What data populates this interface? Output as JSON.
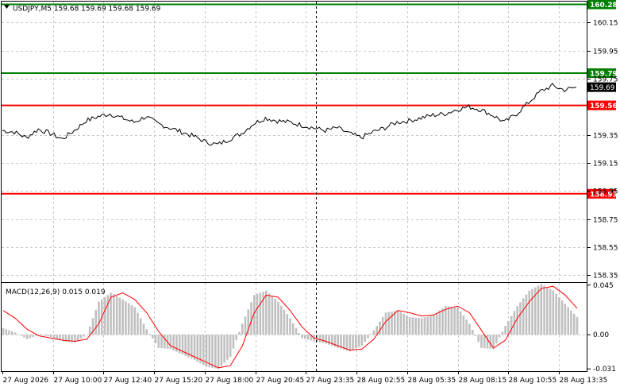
{
  "header": {
    "symbol_line": "USDJPY,M5  159.68 159.69 159.68 159.69"
  },
  "macd": {
    "label": "MACD(12,26,9) 0.015 0.019",
    "axis_labels": [
      "0.045",
      "0.00",
      "-0.031"
    ]
  },
  "colors": {
    "green_line": "#008000",
    "red_line": "#ff0000",
    "price_line": "#000000",
    "histogram": "#c0c0c0",
    "signal": "#ff0000",
    "grid": "#c8c8c8"
  },
  "chart_data": [
    {
      "type": "line",
      "title": "USDJPY,M5",
      "price_axis_ticks": [
        "160.15",
        "159.95",
        "159.75",
        "159.35",
        "159.15",
        "158.95",
        "158.75",
        "158.55",
        "158.35"
      ],
      "ylim": [
        158.3,
        160.3
      ],
      "time_labels": [
        "27 Aug 2026",
        "27 Aug 10:00",
        "27 Aug 12:40",
        "27 Aug 15:20",
        "27 Aug 18:00",
        "27 Aug 20:45",
        "27 Aug 23:35",
        "28 Aug 02:55",
        "28 Aug 05:35",
        "28 Aug 08:15",
        "28 Aug 10:55",
        "28 Aug 13:35"
      ],
      "levels": [
        {
          "value": 160.28,
          "label": "160.28",
          "color": "green"
        },
        {
          "value": 159.79,
          "label": "159.79",
          "color": "green"
        },
        {
          "value": 159.56,
          "label": "159.56",
          "color": "red"
        },
        {
          "value": 158.93,
          "label": "158.93",
          "color": "red"
        }
      ],
      "current_price": {
        "value": 159.69,
        "label": "159.69"
      },
      "series": [
        {
          "values": [
            159.38,
            159.37,
            159.33,
            159.39,
            159.36,
            159.32,
            159.38,
            159.45,
            159.48,
            159.5,
            159.47,
            159.44,
            159.48,
            159.43,
            159.4,
            159.37,
            159.34,
            159.3,
            159.28,
            159.32,
            159.36,
            159.43,
            159.47,
            159.45,
            159.44,
            159.42,
            159.4,
            159.38,
            159.4,
            159.36,
            159.33,
            159.37,
            159.4,
            159.44,
            159.45,
            159.47,
            159.49,
            159.5,
            159.53,
            159.55,
            159.53,
            159.49,
            159.44,
            159.5,
            159.58,
            159.66,
            159.7,
            159.67,
            159.69
          ]
        }
      ]
    },
    {
      "type": "bar",
      "title": "MACD(12,26,9)",
      "ylim": [
        -0.033,
        0.047
      ],
      "series": [
        {
          "name": "MACD",
          "values": [
            0.006,
            0.002,
            -0.004,
            0.0,
            -0.002,
            -0.006,
            -0.007,
            0.0,
            0.03,
            0.038,
            0.032,
            0.025,
            0.005,
            -0.012,
            -0.013,
            -0.018,
            -0.023,
            -0.029,
            -0.031,
            -0.02,
            0.01,
            0.036,
            0.04,
            0.03,
            0.015,
            -0.003,
            -0.006,
            -0.008,
            -0.012,
            -0.015,
            -0.01,
            0.004,
            0.02,
            0.022,
            0.016,
            0.015,
            0.018,
            0.026,
            0.025,
            0.01,
            -0.012,
            -0.013,
            0.008,
            0.026,
            0.04,
            0.046,
            0.04,
            0.028,
            0.016
          ]
        },
        {
          "name": "Signal",
          "values": [
            0.022,
            0.015,
            0.005,
            -0.001,
            -0.003,
            -0.005,
            -0.006,
            -0.004,
            0.01,
            0.034,
            0.038,
            0.032,
            0.02,
            0.003,
            -0.01,
            -0.015,
            -0.02,
            -0.025,
            -0.03,
            -0.028,
            -0.01,
            0.02,
            0.036,
            0.034,
            0.022,
            0.007,
            -0.003,
            -0.006,
            -0.01,
            -0.014,
            -0.013,
            -0.004,
            0.012,
            0.022,
            0.02,
            0.017,
            0.018,
            0.023,
            0.026,
            0.02,
            0.004,
            -0.012,
            -0.005,
            0.015,
            0.03,
            0.042,
            0.044,
            0.036,
            0.024
          ]
        }
      ]
    }
  ]
}
